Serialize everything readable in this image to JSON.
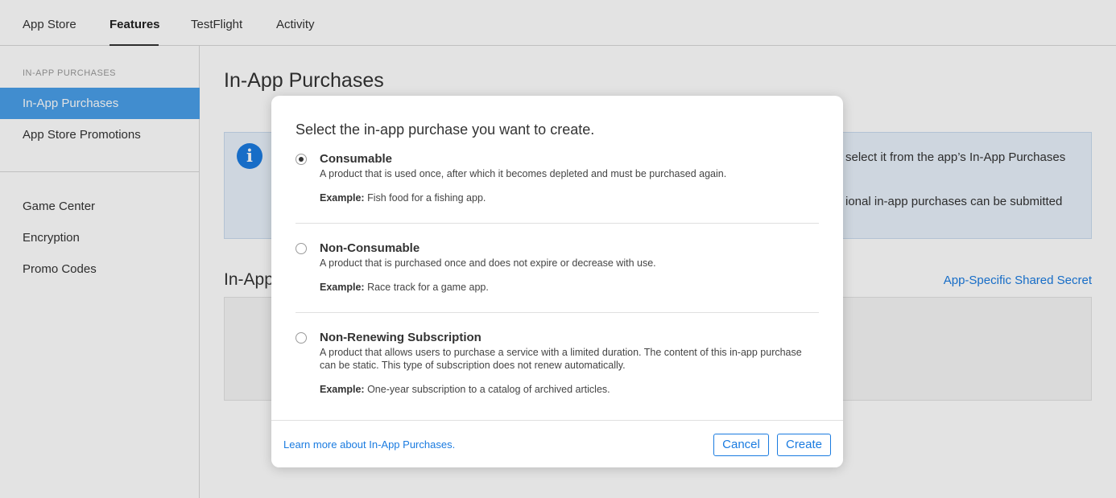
{
  "topnav": {
    "tabs": [
      {
        "label": "App Store"
      },
      {
        "label": "Features"
      },
      {
        "label": "TestFlight"
      },
      {
        "label": "Activity"
      }
    ],
    "active_tab": "Features"
  },
  "sidebar": {
    "section_label": "IN-APP PURCHASES",
    "items": [
      {
        "label": "In-App Purchases"
      },
      {
        "label": "App Store Promotions"
      },
      {
        "label": "Game Center"
      },
      {
        "label": "Encryption"
      },
      {
        "label": "Promo Codes"
      }
    ],
    "active_item": "In-App Purchases"
  },
  "main": {
    "page_title": "In-App Purchases",
    "info": {
      "icon": "info-icon",
      "line1": "select it from the app’s In-App Purchases",
      "line2": "ional in-app purchases can be submitted"
    },
    "section_title": "In-App",
    "secret_link": "App-Specific Shared Secret"
  },
  "modal": {
    "title": "Select the in-app purchase you want to create.",
    "options": [
      {
        "title": "Consumable",
        "description": "A product that is used once, after which it becomes depleted and must be purchased again.",
        "example_label": "Example:",
        "example_text": "Fish food for a fishing app.",
        "selected": true
      },
      {
        "title": "Non-Consumable",
        "description": "A product that is purchased once and does not expire or decrease with use.",
        "example_label": "Example:",
        "example_text": "Race track for a game app.",
        "selected": false
      },
      {
        "title": "Non-Renewing Subscription",
        "description": "A product that allows users to purchase a service with a limited duration. The content of this in-app purchase can be static. This type of subscription does not renew automatically.",
        "example_label": "Example:",
        "example_text": "One-year subscription to a catalog of archived articles.",
        "selected": false
      }
    ],
    "learn_more": "Learn more about In-App Purchases.",
    "cancel_label": "Cancel",
    "create_label": "Create"
  },
  "colors": {
    "accent": "#1a7be0",
    "sidebar_active": "#4a9fe9",
    "info_background": "#e8f1fb"
  }
}
